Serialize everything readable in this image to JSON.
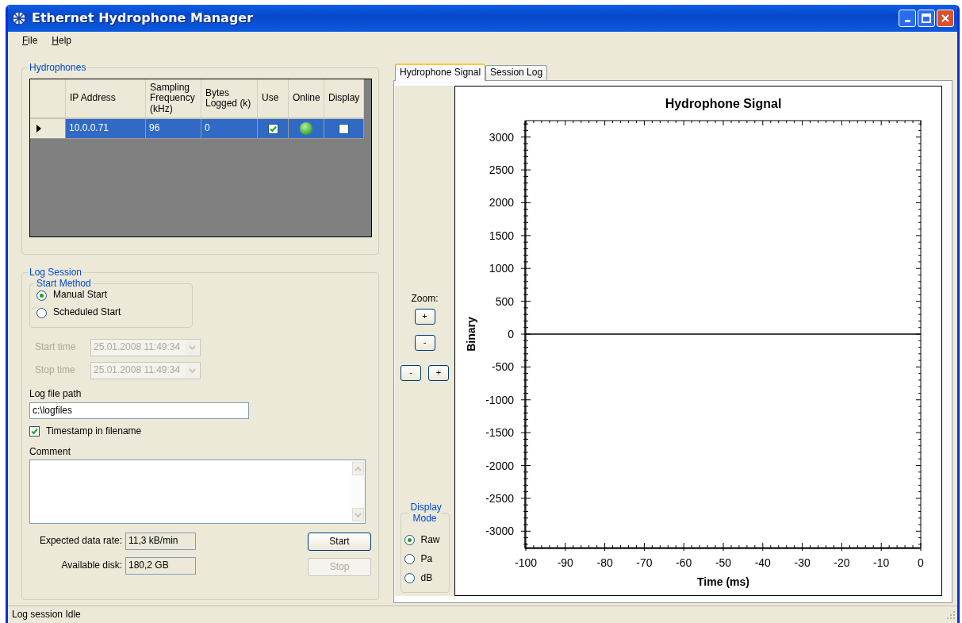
{
  "window": {
    "title": "Ethernet Hydrophone Manager"
  },
  "menu": [
    {
      "label": "File"
    },
    {
      "label": "Help"
    }
  ],
  "hydrophones": {
    "title": "Hydrophones",
    "columns": [
      "IP Address",
      "Sampling Frequency (kHz)",
      "Bytes Logged (k)",
      "Use",
      "Online",
      "Display"
    ],
    "rows": [
      {
        "selected": true,
        "ip_address": "10.0.0.71",
        "sampling_frequency": "96",
        "bytes_logged": "0",
        "use": true,
        "online": true,
        "display": false
      }
    ]
  },
  "log_session": {
    "title": "Log Session",
    "start_method": {
      "title": "Start Method",
      "options": [
        {
          "label": "Manual Start",
          "selected": true
        },
        {
          "label": "Scheduled Start",
          "selected": false
        }
      ]
    },
    "times": [
      {
        "label": "Start time",
        "value": "25.01.2008 11:49:34",
        "disabled": true
      },
      {
        "label": "Stop time",
        "value": "25.01.2008 11:49:34",
        "disabled": true
      }
    ],
    "log_file_path": {
      "label": "Log file path",
      "value": "c:\\logfiles"
    },
    "timestamp_in_filename": {
      "label": "Timestamp in filename",
      "checked": true
    },
    "comment": {
      "label": "Comment"
    },
    "stats": [
      {
        "label": "Expected data rate:",
        "value": "11,3 kB/min"
      },
      {
        "label": "Available disk:",
        "value": "180,2 GB"
      }
    ],
    "buttons": [
      {
        "label": "Start",
        "disabled": false
      },
      {
        "label": "Stop",
        "disabled": true
      }
    ]
  },
  "tabs": [
    {
      "label": "Hydrophone Signal",
      "selected": true
    },
    {
      "label": "Session Log",
      "selected": false
    }
  ],
  "zoom": {
    "label": "Zoom:",
    "vertical": [
      "+",
      "-"
    ],
    "horizontal": [
      "-",
      "+"
    ]
  },
  "display_mode": {
    "title": "Display Mode",
    "options": [
      {
        "label": "Raw",
        "selected": true
      },
      {
        "label": "Pa",
        "selected": false
      },
      {
        "label": "dB",
        "selected": false
      }
    ]
  },
  "chart_data": {
    "type": "line",
    "title": "Hydrophone Signal",
    "xlabel": "Time (ms)",
    "ylabel": "Binary",
    "x": [
      -100,
      0
    ],
    "series": [
      {
        "color": "#000000",
        "values": [
          0,
          0
        ]
      }
    ],
    "xlim": [
      -100,
      0
    ],
    "ylim": [
      -3250,
      3250
    ],
    "xticks": [
      -100,
      -90,
      -80,
      -70,
      -60,
      -50,
      -40,
      -30,
      -20,
      -10,
      0
    ],
    "yticks": [
      -3000,
      -2500,
      -2000,
      -1500,
      -1000,
      -500,
      0,
      500,
      1000,
      1500,
      2000,
      2500,
      3000
    ]
  },
  "status_bar": {
    "text": "Log session Idle"
  }
}
